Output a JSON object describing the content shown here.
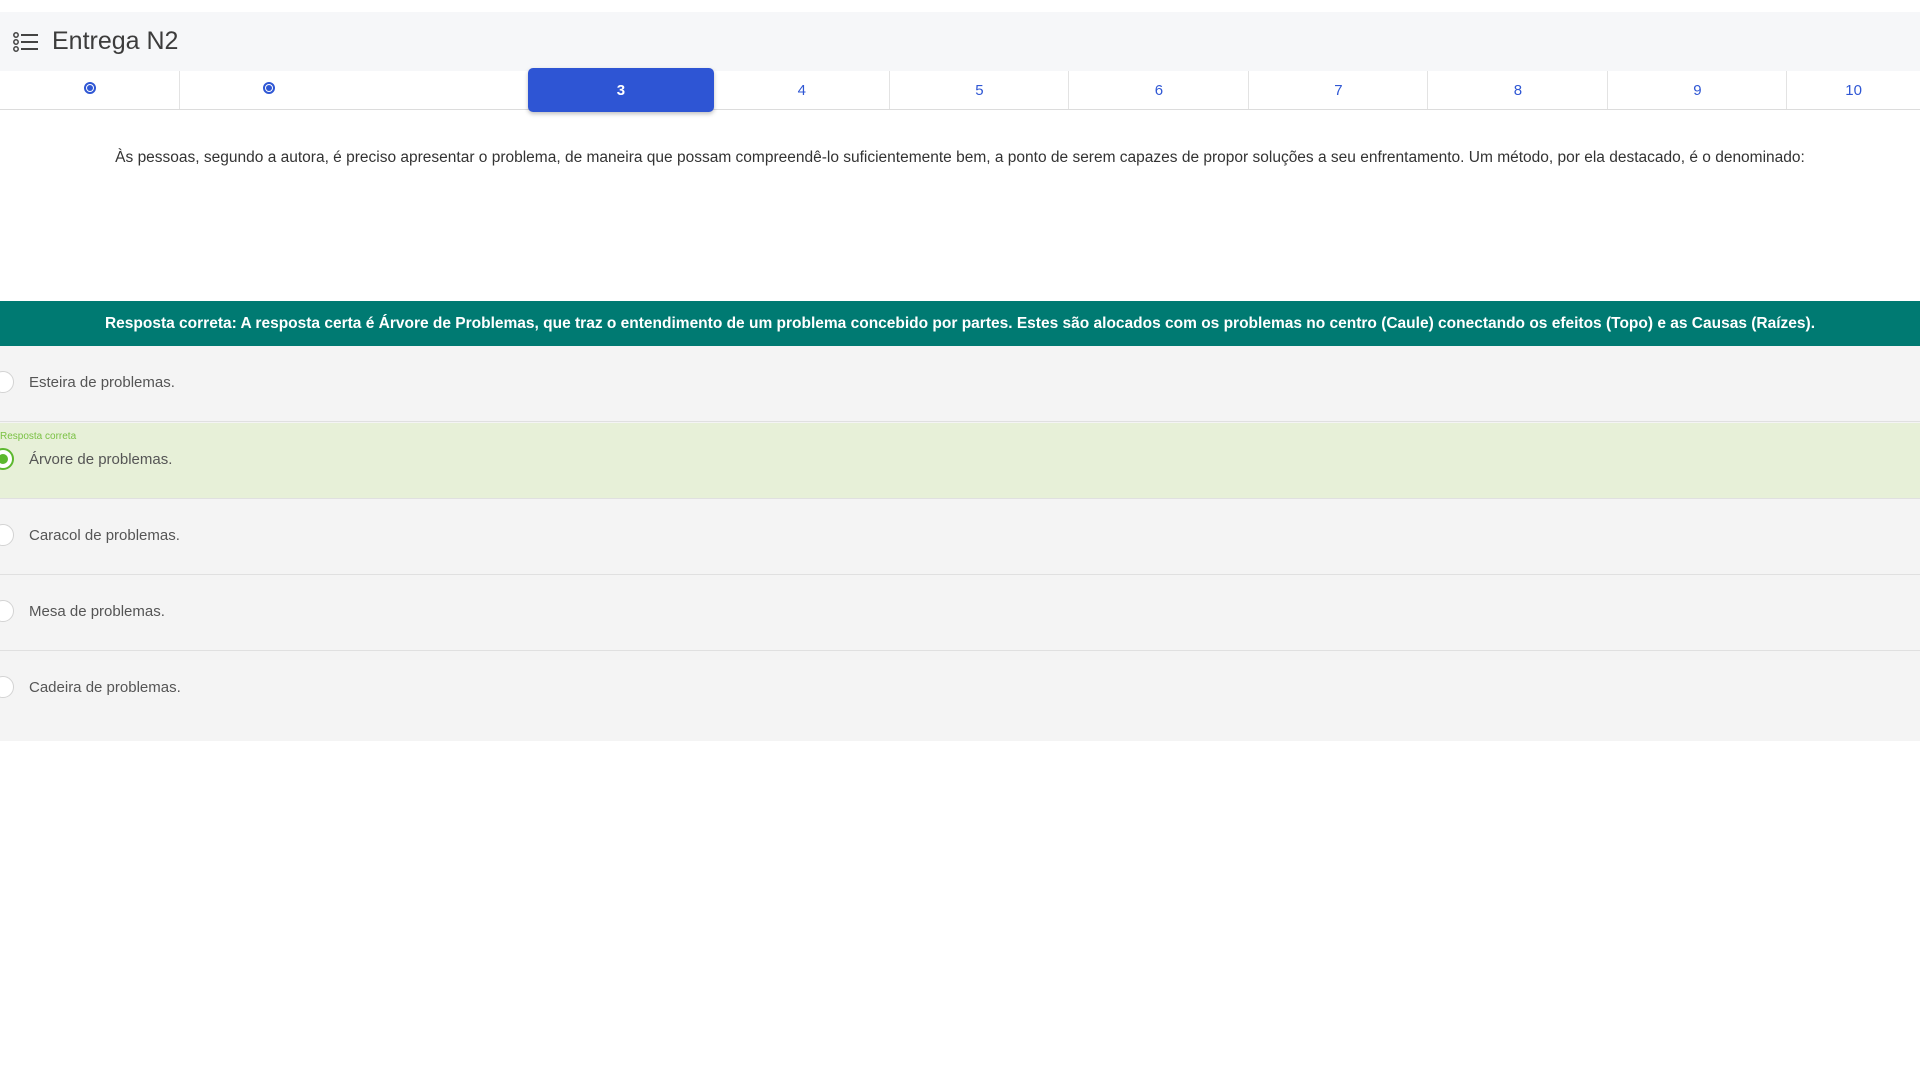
{
  "header": {
    "title": "Entrega N2",
    "menu_icon": "list-menu-icon"
  },
  "nav": {
    "items": [
      {
        "label": "",
        "state": "answered"
      },
      {
        "label": "",
        "state": "answered"
      },
      {
        "label": "3",
        "state": "active"
      },
      {
        "label": "4",
        "state": "default"
      },
      {
        "label": "5",
        "state": "default"
      },
      {
        "label": "6",
        "state": "default"
      },
      {
        "label": "7",
        "state": "default"
      },
      {
        "label": "8",
        "state": "default"
      },
      {
        "label": "9",
        "state": "default"
      },
      {
        "label": "10",
        "state": "default"
      }
    ],
    "accent_color": "#2e55d4"
  },
  "question": {
    "text": "Às pessoas, segundo a autora, é preciso apresentar o problema, de maneira que possam compreendê-lo suficientemente bem, a ponto de serem capazes de propor soluções a seu enfrentamento. Um método, por ela destacado, é o denominado:"
  },
  "feedback": {
    "text": "Resposta correta: A resposta certa é Árvore de Problemas, que traz o entendimento de um problema concebido por partes. Estes são alocados com os problemas no centro (Caule) conectando os efeitos (Topo) e as Causas (Raízes).",
    "color": "#007a72"
  },
  "options": [
    {
      "label": "Esteira de problemas.",
      "correct": false,
      "tag": ""
    },
    {
      "label": "Árvore de problemas.",
      "correct": true,
      "tag": "Resposta correta"
    },
    {
      "label": "Caracol de problemas.",
      "correct": false,
      "tag": ""
    },
    {
      "label": "Mesa de problemas.",
      "correct": false,
      "tag": ""
    },
    {
      "label": "Cadeira de problemas.",
      "correct": false,
      "tag": ""
    }
  ],
  "colors": {
    "correct_bg": "#e7f0d8",
    "correct_accent": "#5cb82e"
  }
}
